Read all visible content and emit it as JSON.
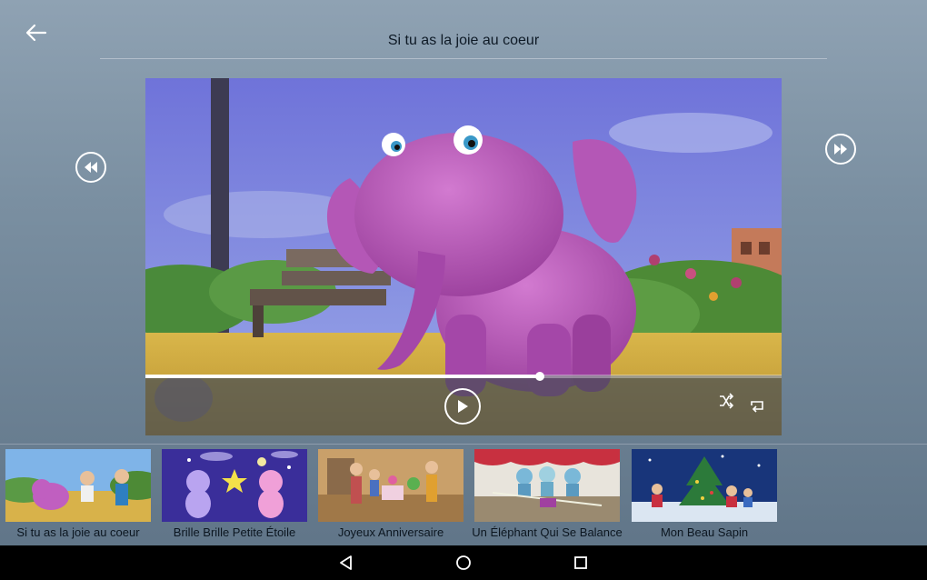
{
  "header": {
    "title": "Si tu as la joie au coeur"
  },
  "player": {
    "progress_fraction": 0.62
  },
  "icons": {
    "back": "arrow-left-icon",
    "rewind": "rewind-icon",
    "forward": "fast-forward-icon",
    "play": "play-icon",
    "shuffle": "shuffle-icon",
    "repeat": "repeat-icon",
    "nav_back": "nav-back-icon",
    "nav_home": "nav-home-icon",
    "nav_recents": "nav-recents-icon"
  },
  "playlist": [
    {
      "label": "Si tu as la joie au coeur"
    },
    {
      "label": "Brille Brille Petite Étoile"
    },
    {
      "label": "Joyeux Anniversaire"
    },
    {
      "label": "Un Éléphant Qui Se Balance"
    },
    {
      "label": "Mon Beau Sapin"
    }
  ],
  "colors": {
    "accent": "#ffffff",
    "elephant": "#c05fc0",
    "controls_bg": "#464e54"
  }
}
